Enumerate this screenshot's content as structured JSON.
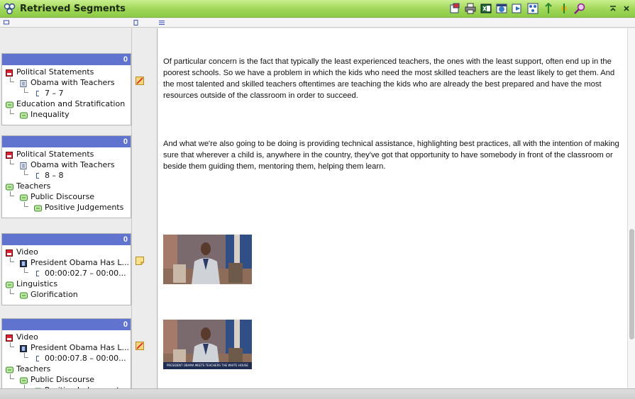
{
  "window": {
    "title": "Retrieved Segments",
    "toolbar_icons": [
      "export-icon",
      "print-icon",
      "excel-icon",
      "web-export-icon",
      "next-icon",
      "network-icon",
      "filter-icon",
      "code-icon",
      "zoom-icon"
    ]
  },
  "segments": [
    {
      "weight": "0",
      "memo": "note-red-icon",
      "tree": [
        {
          "level": 0,
          "icon": "document-group-icon",
          "label": "Political Statements"
        },
        {
          "level": 1,
          "icon": "text-document-icon",
          "label": "Obama with Teachers"
        },
        {
          "level": 2,
          "icon": "range-icon",
          "label": "7 – 7"
        },
        {
          "level": 0,
          "icon": "code-icon",
          "label": "Education and Stratification"
        },
        {
          "level": 1,
          "icon": "code-icon",
          "label": "Inequality"
        }
      ],
      "content": "Of particular concern is the fact that typically the least experienced teachers, the ones with the least support, often end up in the poorest schools.  So we have a problem in which the kids who need the most skilled teachers are the least likely to get them.  And the most talented and skilled teachers oftentimes are teaching the kids who are already the best prepared and have the most resources outside of the classroom in order to succeed."
    },
    {
      "weight": "0",
      "memo": "",
      "tree": [
        {
          "level": 0,
          "icon": "document-group-icon",
          "label": "Political Statements"
        },
        {
          "level": 1,
          "icon": "text-document-icon",
          "label": "Obama with Teachers"
        },
        {
          "level": 2,
          "icon": "range-icon",
          "label": "8 – 8"
        },
        {
          "level": 0,
          "icon": "code-icon",
          "label": "Teachers"
        },
        {
          "level": 1,
          "icon": "code-icon",
          "label": "Public Discourse"
        },
        {
          "level": 2,
          "icon": "code-icon",
          "label": "Positive Judgements"
        }
      ],
      "content": " And what we're also going to be doing is providing technical assistance, highlighting best practices, all with the intention of making sure that wherever a child is, anywhere in the country, they've got that opportunity to have somebody in front of the classroom or beside them guiding them, mentoring them, helping them learn."
    },
    {
      "weight": "0",
      "memo": "note-yellow-icon",
      "tree": [
        {
          "level": 0,
          "icon": "document-group-icon",
          "label": "Video"
        },
        {
          "level": 1,
          "icon": "film-icon",
          "label": "President Obama Has L..."
        },
        {
          "level": 2,
          "icon": "range-icon",
          "label": "00:00:02.7 – 00:00..."
        },
        {
          "level": 0,
          "icon": "code-icon",
          "label": "Linguistics"
        },
        {
          "level": 1,
          "icon": "code-icon",
          "label": "Glorification"
        }
      ],
      "content": ""
    },
    {
      "weight": "0",
      "memo": "note-red-icon",
      "tree": [
        {
          "level": 0,
          "icon": "document-group-icon",
          "label": "Video"
        },
        {
          "level": 1,
          "icon": "film-icon",
          "label": "President Obama Has L..."
        },
        {
          "level": 2,
          "icon": "range-icon",
          "label": "00:00:07.8 – 00:00..."
        },
        {
          "level": 0,
          "icon": "code-icon",
          "label": "Teachers"
        },
        {
          "level": 1,
          "icon": "code-icon",
          "label": "Public Discourse"
        },
        {
          "level": 2,
          "icon": "code-icon",
          "label": "Positive Judgements"
        }
      ],
      "content": ""
    }
  ],
  "video_caption": "PRESIDENT OBAMA MEETS TEACHERS THE WHITE HOUSE",
  "colors": {
    "accent": "#5f73cf",
    "titlebar": "#9fd658"
  }
}
